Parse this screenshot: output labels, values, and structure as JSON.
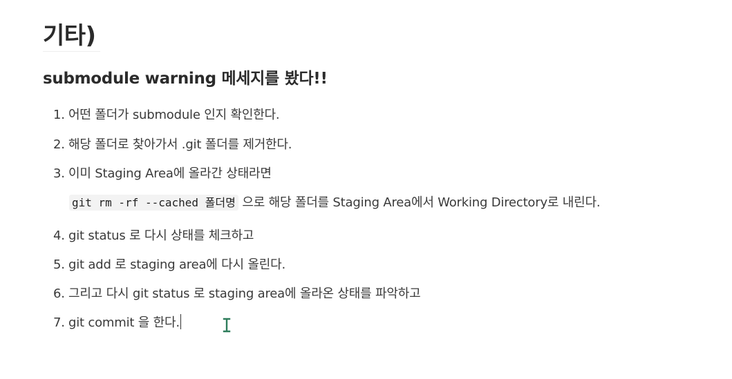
{
  "heading": "기타)",
  "subheading": "submodule warning 메세지를 봤다!!",
  "list": [
    {
      "num": "1.",
      "text": "어떤 폴더가 submodule 인지 확인한다."
    },
    {
      "num": "2.",
      "text": "해당 폴더로 찾아가서 .git 폴더를 제거한다."
    },
    {
      "num": "3.",
      "text": "이미 Staging Area에 올라간 상태라면"
    },
    {
      "num": "4.",
      "text": "git status 로 다시 상태를 체크하고"
    },
    {
      "num": "5.",
      "text": "git add 로 staging area에 다시 올린다."
    },
    {
      "num": "6.",
      "text": "그리고 다시 git status 로 staging area에 올라온 상태를 파악하고"
    },
    {
      "num": "7.",
      "text": "git commit 을 한다."
    }
  ],
  "subline": {
    "code": "git rm -rf --cached 폴더명",
    "text": " 으로 해당 폴더를 Staging Area에서 Working Directory로 내린다."
  },
  "icons": {
    "text_cursor": "text-cursor-icon",
    "cursor_color": "#2e7d5b"
  }
}
